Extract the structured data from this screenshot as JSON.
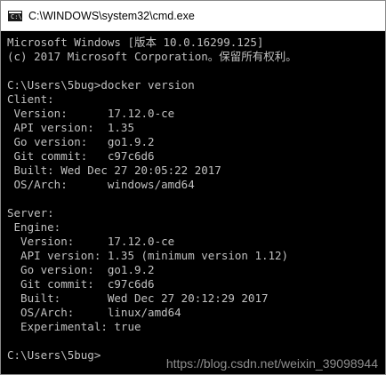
{
  "window": {
    "title": "C:\\WINDOWS\\system32\\cmd.exe",
    "icon": "cmd-console-icon"
  },
  "console": {
    "lines": [
      "Microsoft Windows [版本 10.0.16299.125]",
      "(c) 2017 Microsoft Corporation。保留所有权利。",
      "",
      "C:\\Users\\5bug>docker version",
      "Client:",
      " Version:      17.12.0-ce",
      " API version:  1.35",
      " Go version:   go1.9.2",
      " Git commit:   c97c6d6",
      " Built: Wed Dec 27 20:05:22 2017",
      " OS/Arch:      windows/amd64",
      "",
      "Server:",
      " Engine:",
      "  Version:     17.12.0-ce",
      "  API version: 1.35 (minimum version 1.12)",
      "  Go version:  go1.9.2",
      "  Git commit:  c97c6d6",
      "  Built:       Wed Dec 27 20:12:29 2017",
      "  OS/Arch:     linux/amd64",
      "  Experimental: true",
      "",
      "C:\\Users\\5bug>"
    ]
  },
  "watermark": "https://blog.csdn.net/weixin_39098944",
  "colors": {
    "console_background": "#000000",
    "console_text": "#c0c0c0",
    "titlebar_background": "#ffffff"
  }
}
